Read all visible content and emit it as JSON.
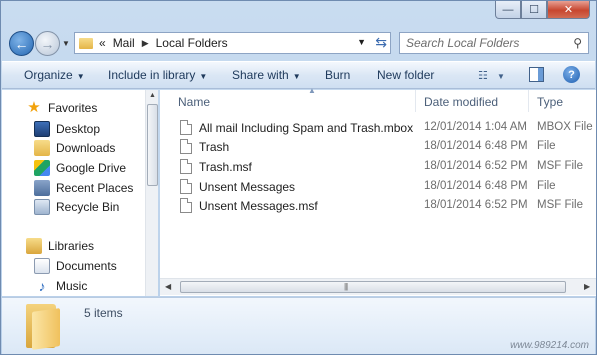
{
  "address_bar": {
    "overflow": "«",
    "parts": [
      "Mail",
      "Local Folders"
    ]
  },
  "search": {
    "placeholder": "Search Local Folders"
  },
  "toolbar": {
    "organize": "Organize",
    "include_in_library": "Include in library",
    "share_with": "Share with",
    "burn": "Burn",
    "new_folder": "New folder",
    "help": "?"
  },
  "navigation": {
    "favorites_label": "Favorites",
    "favorites": [
      "Desktop",
      "Downloads",
      "Google Drive",
      "Recent Places",
      "Recycle Bin"
    ],
    "libraries_label": "Libraries",
    "libraries": [
      "Documents",
      "Music"
    ]
  },
  "columns": {
    "name": "Name",
    "date_modified": "Date modified",
    "type": "Type"
  },
  "files": [
    {
      "name": "All mail Including Spam and Trash.mbox",
      "date": "12/01/2014 1:04 AM",
      "type": "MBOX File"
    },
    {
      "name": "Trash",
      "date": "18/01/2014 6:48 PM",
      "type": "File"
    },
    {
      "name": "Trash.msf",
      "date": "18/01/2014 6:52 PM",
      "type": "MSF File"
    },
    {
      "name": "Unsent Messages",
      "date": "18/01/2014 6:48 PM",
      "type": "File"
    },
    {
      "name": "Unsent Messages.msf",
      "date": "18/01/2014 6:52 PM",
      "type": "MSF File"
    }
  ],
  "status": {
    "item_count": "5 items"
  },
  "watermark": "www.989214.com",
  "icons": {
    "back": "back-arrow-icon",
    "forward": "forward-arrow-icon",
    "refresh": "refresh-icon",
    "search": "search-icon",
    "file": "file-icon",
    "folder": "folder-icon"
  },
  "colors": {
    "accent": "#2567b2",
    "toolbar_text": "#1e395b",
    "secondary_text": "#6d6d6d"
  }
}
